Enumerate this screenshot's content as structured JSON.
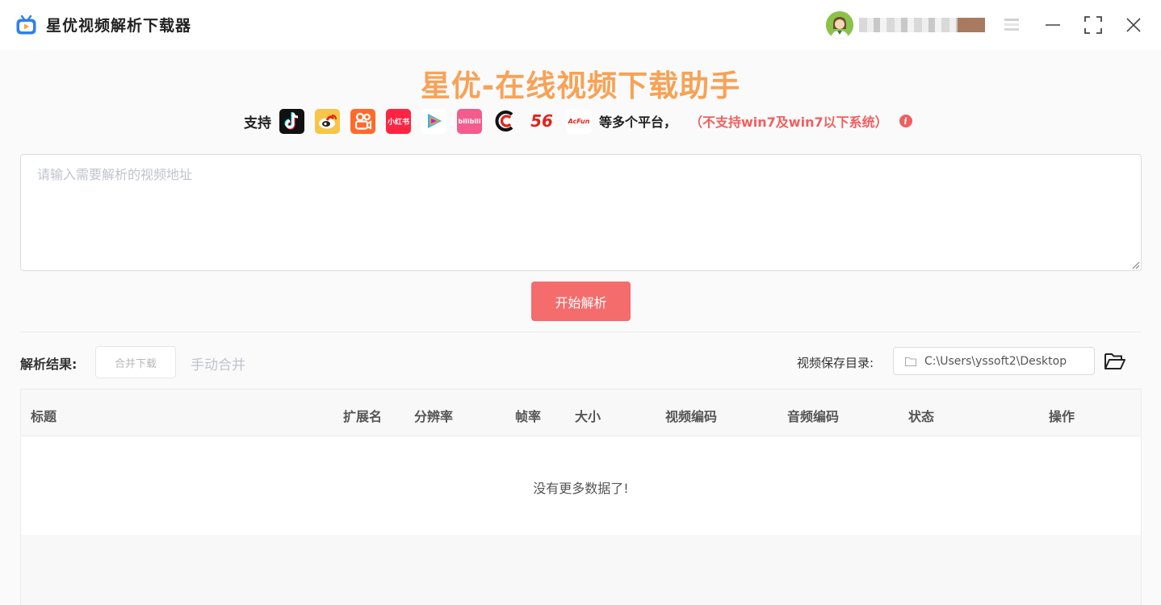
{
  "window": {
    "title": "星优视频解析下载器",
    "username": ""
  },
  "hero": {
    "headline": "星优-在线视频下载助手",
    "support_label": "支持",
    "platforms": [
      {
        "name": "douyin",
        "text": "",
        "color": "#111111"
      },
      {
        "name": "weibo",
        "text": "",
        "color": "#f7c548"
      },
      {
        "name": "kuaishou",
        "text": "",
        "color": "#ff6a2b"
      },
      {
        "name": "xiaohongshu",
        "text": "小红书",
        "color": "#ff2442"
      },
      {
        "name": "tencent-video",
        "text": "",
        "color": "#ffffff"
      },
      {
        "name": "bilibili",
        "text": "bilibili",
        "color": "#f25d8e"
      },
      {
        "name": "cctv",
        "text": "",
        "color": "#ffffff"
      },
      {
        "name": "56",
        "text": "56",
        "color": "#ffffff"
      },
      {
        "name": "acfun",
        "text": "AcFun",
        "color": "#ffffff"
      }
    ],
    "more_label": "等多个平台，",
    "warning": "（不支持win7及win7以下系统）",
    "accent_color": "#f7a256",
    "warning_color": "#ef5f5f"
  },
  "url_input": {
    "placeholder": "请输入需要解析的视频地址",
    "value": ""
  },
  "parse_button": {
    "label": "开始解析",
    "color": "#f56c6c"
  },
  "results": {
    "label": "解析结果:",
    "merge_download_label": "合并下载",
    "manual_merge_label": "手动合并",
    "save_dir_label": "视频保存目录:",
    "save_dir_value": "C:\\Users\\yssoft2\\Desktop"
  },
  "table": {
    "columns": [
      "标题",
      "扩展名",
      "分辨率",
      "帧率",
      "大小",
      "视频编码",
      "音频编码",
      "状态",
      "操作"
    ],
    "empty_text": "没有更多数据了!"
  }
}
